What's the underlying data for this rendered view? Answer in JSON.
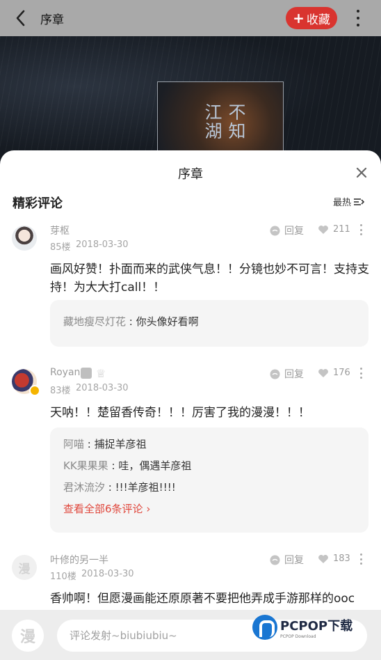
{
  "topbar": {
    "title": "序章",
    "favorite_label": "收藏"
  },
  "cover": {
    "col1": "江湖",
    "col2": "不知"
  },
  "sheet": {
    "title": "序章",
    "section_title": "精彩评论",
    "sort_label": "最热"
  },
  "comments": [
    {
      "username": "芽枢",
      "floor": "85楼",
      "date": "2018-03-30",
      "reply_label": "回复",
      "likes": "211",
      "body": "画风好赞！扑面而来的武侠气息！！分镜也妙不可言！支持支持！为大大打call！！",
      "replies": [
        {
          "user": "藏地瘦尽灯花",
          "sep": ":",
          "text": "你头像好看啊"
        }
      ]
    },
    {
      "username": "Royan",
      "floor": "83楼",
      "date": "2018-03-30",
      "reply_label": "回复",
      "likes": "176",
      "body": "天呐！！楚留香传奇！！！厉害了我的漫漫！！！",
      "replies": [
        {
          "user": "阿喵",
          "sep": ":",
          "text": "捕捉羊彦祖"
        },
        {
          "user": "KK果果果",
          "sep": ":",
          "text": "哇，偶遇羊彦祖"
        },
        {
          "user": "君沐流汐",
          "sep": ":",
          "text": "!!!羊彦祖!!!!"
        }
      ],
      "see_all": "查看全部6条评论"
    },
    {
      "username": "叶修的另一半",
      "floor": "110楼",
      "date": "2018-03-30",
      "reply_label": "回复",
      "likes": "183",
      "body": "香帅啊！但愿漫画能还原原著不要把他弄成手游那样的ooc",
      "avatar_text": "漫"
    }
  ],
  "bottom": {
    "avatar_text": "漫",
    "placeholder": "评论发射~biubiubiu~"
  },
  "watermark": {
    "brand": "PCPOP下载",
    "sub": "PCPOP Download"
  },
  "colors": {
    "accent": "#d9342f",
    "link": "#e0473c",
    "muted": "#9b9b9b"
  }
}
